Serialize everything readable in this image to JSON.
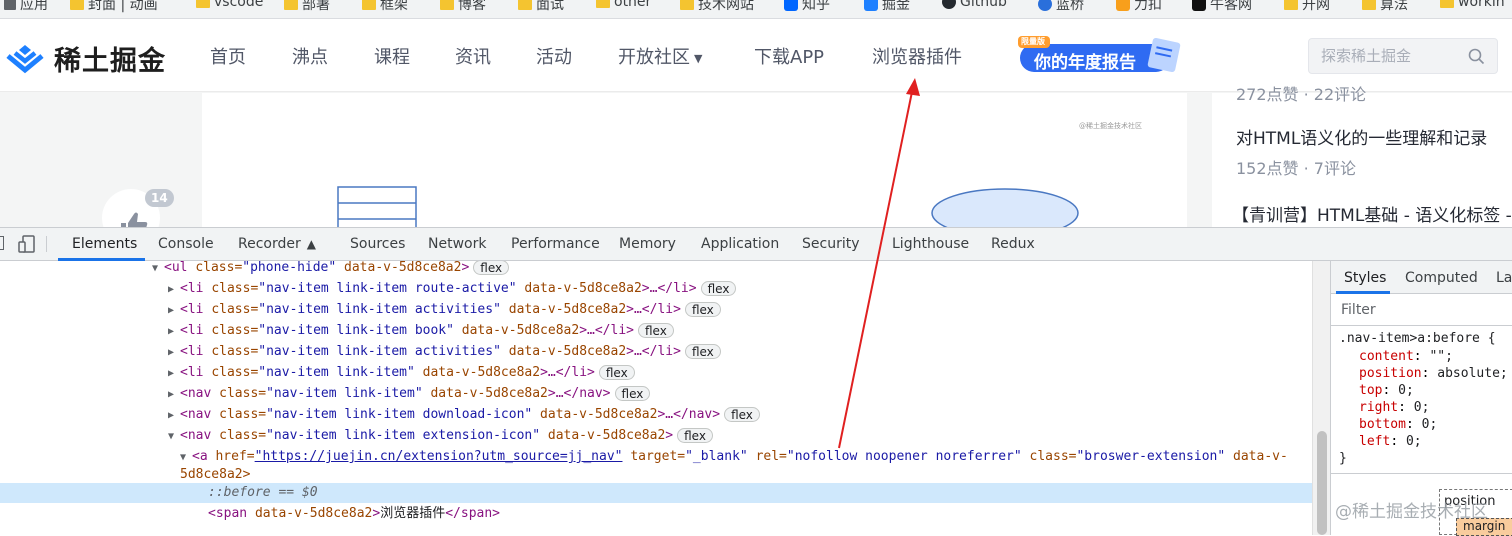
{
  "bookmarks": [
    "应用",
    "封面 | 动画",
    "vscode",
    "部署",
    "框架",
    "博客",
    "面试",
    "other",
    "技术网站",
    "知乎",
    "掘金",
    "Github",
    "蓝桥",
    "力扣",
    "牛客网",
    "开网",
    "算法",
    "workin"
  ],
  "site": {
    "logo_text": "稀土掘金",
    "nav": [
      {
        "label": "首页"
      },
      {
        "label": "沸点"
      },
      {
        "label": "课程"
      },
      {
        "label": "资讯"
      },
      {
        "label": "活动"
      },
      {
        "label": "开放社区"
      },
      {
        "label": "下载APP"
      },
      {
        "label": "浏览器插件"
      }
    ],
    "banner_text": "你的年度报告",
    "banner_tag": "限量版",
    "search_placeholder": "探索稀土掘金",
    "like_count": "14",
    "article_watermark": "@稀土掘金技术社区",
    "side": [
      {
        "title": "",
        "meta": "272点赞 · 22评论"
      },
      {
        "title": "对HTML语义化的一些理解和记录",
        "meta": "152点赞 · 7评论"
      },
      {
        "title": "【青训营】HTML基础 - 语义化标签 -",
        "meta": ""
      }
    ]
  },
  "devtools": {
    "tabs": [
      "Elements",
      "Console",
      "Recorder",
      "Sources",
      "Network",
      "Performance",
      "Memory",
      "Application",
      "Security",
      "Lighthouse",
      "Redux"
    ],
    "active_tab": "Elements",
    "dom": {
      "ul_tag": "<ul",
      "ul_class": "\"phone-hide\"",
      "attr_class": "class=",
      "attr_data": "data-v-5d8ce8a2",
      "li_lines": [
        {
          "cls": "\"nav-item link-item route-active\""
        },
        {
          "cls": "\"nav-item link-item activities\""
        },
        {
          "cls": "\"nav-item link-item book\""
        },
        {
          "cls": "\"nav-item link-item activities\""
        },
        {
          "cls": "\"nav-item link-item\""
        }
      ],
      "nav_lines": [
        {
          "cls": "\"nav-item link-item\""
        },
        {
          "cls": "\"nav-item link-item download-icon\""
        },
        {
          "cls": "\"nav-item link-item extension-icon\""
        }
      ],
      "li_open": "<li",
      "li_close": ">…</li>",
      "nav_open": "<nav",
      "nav_close": ">…</nav>",
      "flex_badge": "flex",
      "a_open": "<a",
      "href_attr": "href=",
      "href_value": "\"https://juejin.cn/extension?utm_source=jj_nav\"",
      "target_attr": "target=",
      "target_value": "\"_blank\"",
      "rel_attr": "rel=",
      "rel_value": "\"nofollow noopener noreferrer\"",
      "a_class_value": "\"broswer-extension\"",
      "data_v_prefix": "data-v-",
      "data_v_suffix": "5d8ce8a2>",
      "before_text": "::before == $0",
      "span_open": "<span",
      "span_attr": "data-v-5d8ce8a2",
      "span_text": "浏览器插件",
      "span_close": "</span>"
    },
    "styles": {
      "tabs": [
        "Styles",
        "Computed",
        "Lay"
      ],
      "filter_placeholder": "Filter",
      "selector": ".nav-item>a:before {",
      "props": [
        {
          "name": "content",
          "value": "\"\";"
        },
        {
          "name": "position",
          "value": "absolute;"
        },
        {
          "name": "top",
          "value": "0;"
        },
        {
          "name": "right",
          "value": "0;"
        },
        {
          "name": "bottom",
          "value": "0;"
        },
        {
          "name": "left",
          "value": "0;"
        }
      ],
      "close_brace": "}",
      "box_position": "position",
      "box_margin": "margin",
      "watermark": "@稀土掘金技术社区"
    }
  },
  "colors": {
    "accent": "#1a73e8",
    "logo_blue": "#1e80ff",
    "arrow": "#e02020"
  }
}
